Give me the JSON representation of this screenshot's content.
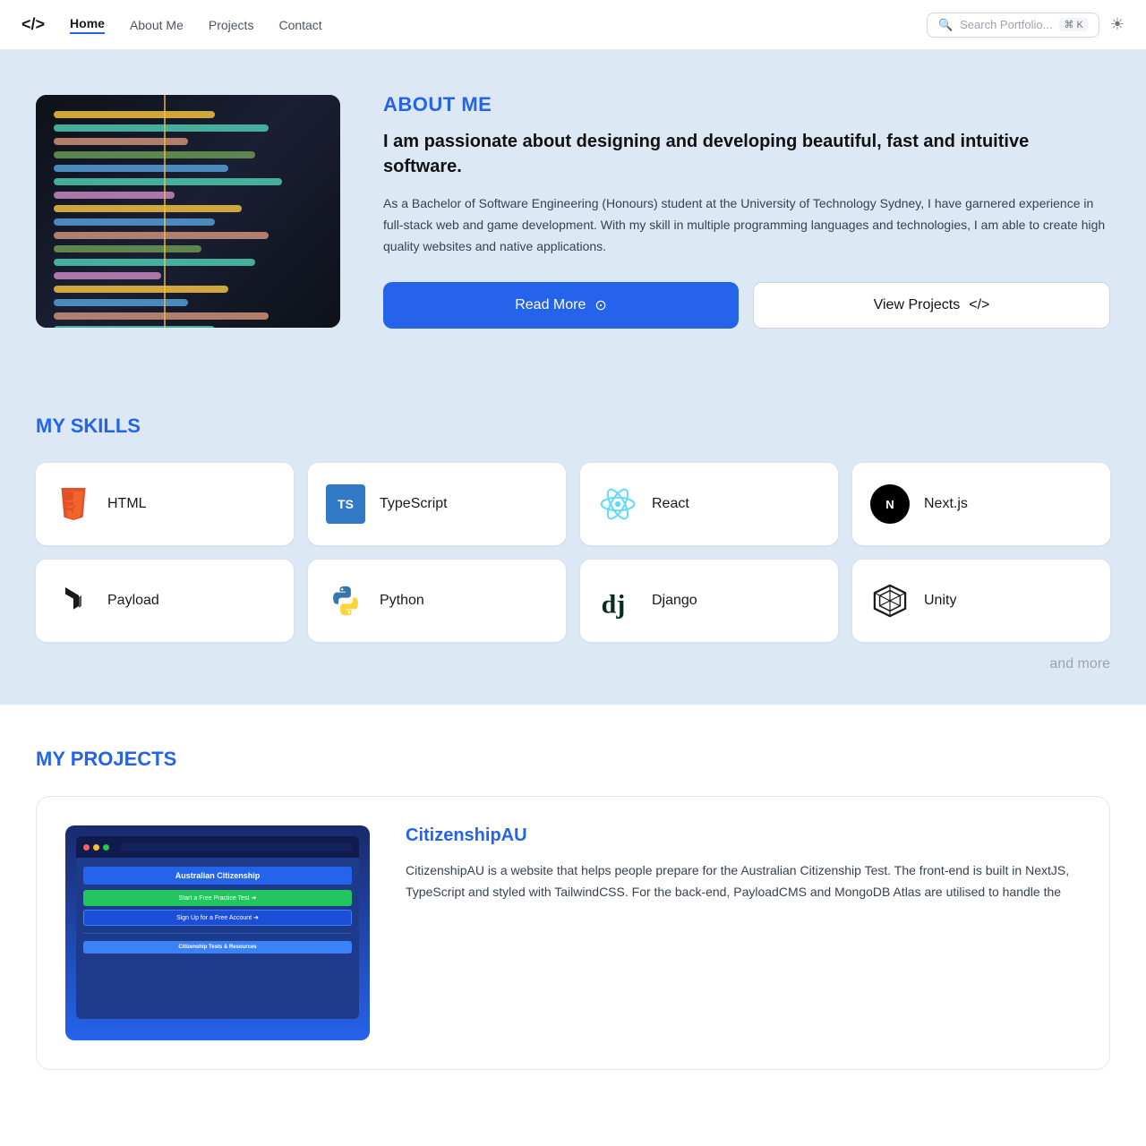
{
  "nav": {
    "logo": "</>",
    "links": [
      {
        "label": "Home",
        "active": true
      },
      {
        "label": "About Me",
        "active": false
      },
      {
        "label": "Projects",
        "active": false
      },
      {
        "label": "Contact",
        "active": false
      }
    ],
    "search_placeholder": "Search Portfolio...",
    "search_kbd": "⌘ K",
    "theme_icon": "☀"
  },
  "hero": {
    "title": "ABOUT ME",
    "subtitle": "I am passionate about designing and developing beautiful, fast and intuitive software.",
    "description": "As a Bachelor of Software Engineering (Honours) student at the University of Technology Sydney, I have garnered experience in full-stack web and game development. With my skill in multiple programming languages and technologies, I am able to create high quality websites and native applications.",
    "btn_read_more": "Read More",
    "btn_view_projects": "View Projects",
    "btn_view_icon": "</>"
  },
  "skills": {
    "title": "MY SKILLS",
    "items": [
      {
        "name": "HTML",
        "icon_type": "html"
      },
      {
        "name": "TypeScript",
        "icon_type": "ts"
      },
      {
        "name": "React",
        "icon_type": "react"
      },
      {
        "name": "Next.js",
        "icon_type": "nextjs"
      },
      {
        "name": "Payload",
        "icon_type": "payload"
      },
      {
        "name": "Python",
        "icon_type": "python"
      },
      {
        "name": "Django",
        "icon_type": "django"
      },
      {
        "name": "Unity",
        "icon_type": "unity"
      }
    ],
    "and_more": "and more"
  },
  "projects": {
    "title": "MY PROJECTS",
    "items": [
      {
        "name": "CitizenshipAU",
        "description": "CitizenshipAU is a website that helps people prepare for the Australian Citizenship Test. The front-end is built in NextJS, TypeScript and styled with TailwindCSS. For the back-end, PayloadCMS and MongoDB Atlas are utilised to handle the"
      }
    ]
  }
}
